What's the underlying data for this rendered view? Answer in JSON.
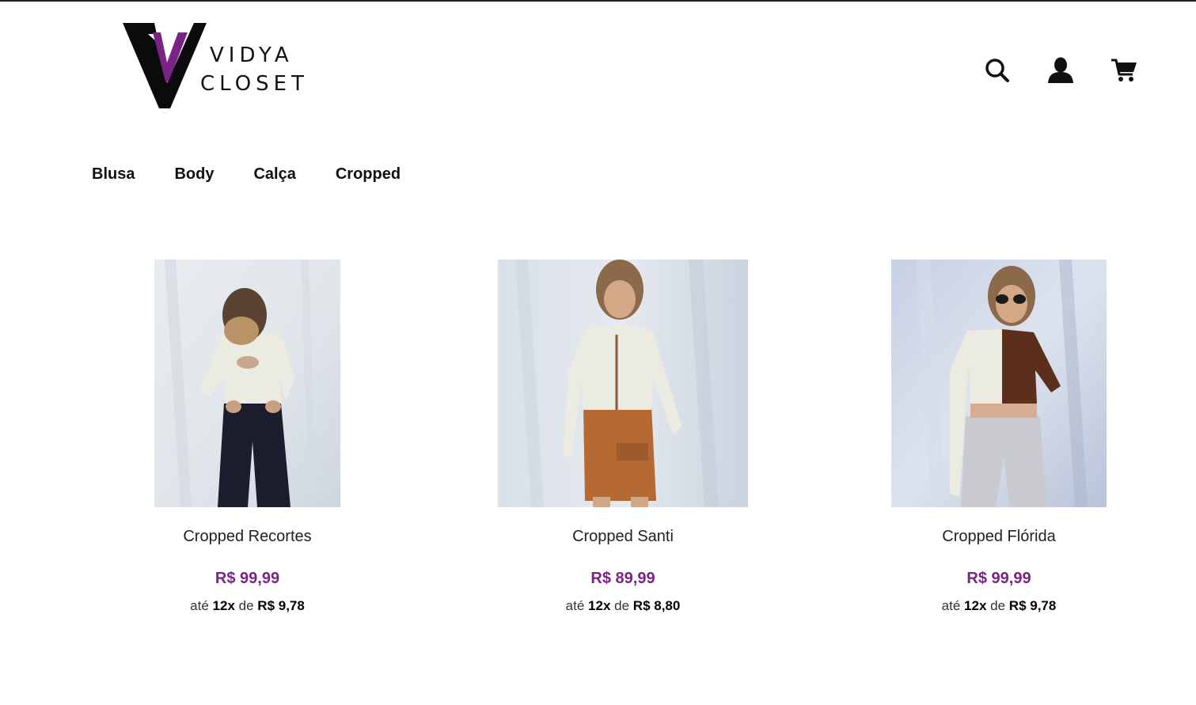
{
  "brand": {
    "name_line1": "VIDYA",
    "name_line2": "CLOSET",
    "accent_color": "#7b2384"
  },
  "header": {
    "icons": [
      "search-icon",
      "user-icon",
      "cart-icon"
    ]
  },
  "nav": {
    "items": [
      "Blusa",
      "Body",
      "Calça",
      "Cropped"
    ]
  },
  "products": [
    {
      "name": "Cropped Recortes",
      "price": "R$ 99,99",
      "inst_prefix": "até",
      "inst_count": "12x",
      "inst_mid": "de",
      "inst_value": "R$ 9,78"
    },
    {
      "name": "Cropped Santi",
      "price": "R$ 89,99",
      "inst_prefix": "até",
      "inst_count": "12x",
      "inst_mid": "de",
      "inst_value": "R$ 8,80"
    },
    {
      "name": "Cropped Flórida",
      "price": "R$ 99,99",
      "inst_prefix": "até",
      "inst_count": "12x",
      "inst_mid": "de",
      "inst_value": "R$ 9,78"
    }
  ]
}
